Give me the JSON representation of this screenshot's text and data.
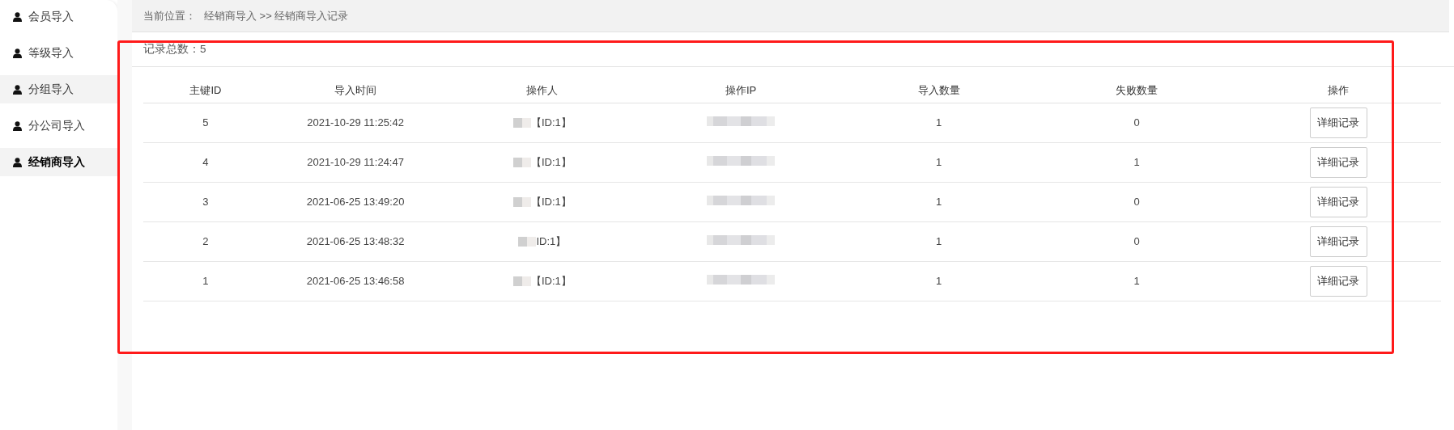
{
  "sidebar": {
    "items": [
      {
        "label": "会员导入",
        "selected": false,
        "hovered": false
      },
      {
        "label": "等级导入",
        "selected": false,
        "hovered": false
      },
      {
        "label": "分组导入",
        "selected": false,
        "hovered": true
      },
      {
        "label": "分公司导入",
        "selected": false,
        "hovered": false
      },
      {
        "label": "经销商导入",
        "selected": true,
        "hovered": false
      }
    ]
  },
  "breadcrumb": {
    "label": "当前位置：",
    "path": "经销商导入 >> 经销商导入记录"
  },
  "summary": {
    "label": "记录总数：",
    "count": "5"
  },
  "highlight_frame": true,
  "table": {
    "columns": [
      "主键ID",
      "导入时间",
      "操作人",
      "操作IP",
      "导入数量",
      "失败数量",
      "操作"
    ],
    "rows": [
      {
        "id": "5",
        "time": "2021-10-29 11:25:42",
        "operator": "【ID:1】",
        "operator_blurred": true,
        "ip_blurred": true,
        "imported": "1",
        "failed": "0",
        "action": "详细记录"
      },
      {
        "id": "4",
        "time": "2021-10-29 11:24:47",
        "operator": "【ID:1】",
        "operator_blurred": true,
        "ip_blurred": true,
        "imported": "1",
        "failed": "1",
        "action": "详细记录"
      },
      {
        "id": "3",
        "time": "2021-06-25 13:49:20",
        "operator": "【ID:1】",
        "operator_blurred": true,
        "ip_blurred": true,
        "imported": "1",
        "failed": "0",
        "action": "详细记录"
      },
      {
        "id": "2",
        "time": "2021-06-25 13:48:32",
        "operator": "ID:1】",
        "operator_blurred": true,
        "ip_blurred": true,
        "imported": "1",
        "failed": "0",
        "action": "详细记录"
      },
      {
        "id": "1",
        "time": "2021-06-25 13:46:58",
        "operator": "【ID:1】",
        "operator_blurred": true,
        "ip_blurred": true,
        "imported": "1",
        "failed": "1",
        "action": "详细记录"
      }
    ]
  }
}
